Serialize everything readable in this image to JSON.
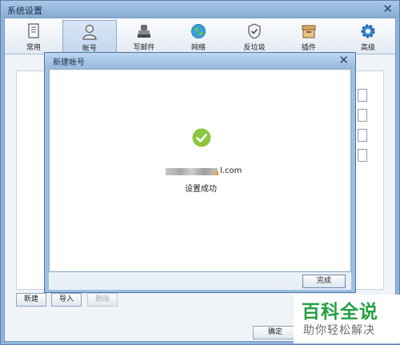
{
  "window": {
    "title": "系统设置"
  },
  "toolbar": {
    "tabs": [
      {
        "label": "常用",
        "icon": "document-icon"
      },
      {
        "label": "帐号",
        "icon": "user-icon"
      },
      {
        "label": "写邮件",
        "icon": "stamp-icon"
      },
      {
        "label": "网络",
        "icon": "globe-icon"
      },
      {
        "label": "反垃圾",
        "icon": "shield-icon"
      },
      {
        "label": "插件",
        "icon": "box-icon"
      },
      {
        "label": "高级",
        "icon": "gear-icon"
      }
    ]
  },
  "account_buttons": {
    "new": "新建",
    "import": "导入",
    "delete": "删除"
  },
  "footer": {
    "ok": "确定"
  },
  "dialog": {
    "title": "新建帐号",
    "email_suffix": "l.com",
    "status": "设置成功",
    "done": "完成"
  },
  "watermark": {
    "title": "百科全说",
    "subtitle": "助你轻松解决"
  },
  "colors": {
    "accent": "#4f76a3",
    "success": "#8cc63f",
    "watermark": "#26a045"
  }
}
